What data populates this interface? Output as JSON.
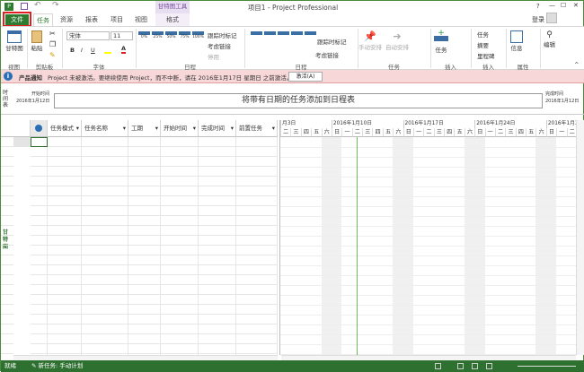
{
  "window": {
    "title": "项目1 - Project Professional",
    "help": "?",
    "minimize": "—",
    "restore": "☐",
    "close": "✕",
    "login": "登录"
  },
  "tabs": {
    "file": "文件",
    "task": "任务",
    "resource": "资源",
    "report": "报表",
    "project": "项目",
    "view": "视图",
    "contextual_group": "甘特图工具",
    "format": "格式"
  },
  "ribbon": {
    "view_group": {
      "label": "视图",
      "gantt": "甘特图"
    },
    "clipboard_group": {
      "label": "剪贴板",
      "paste": "粘贴"
    },
    "font_group": {
      "label": "字体",
      "font_name": "宋体",
      "font_size": "11",
      "bold": "B",
      "italic": "I",
      "underline": "U"
    },
    "schedule_group": {
      "label": "日程",
      "percents": [
        "0%",
        "25%",
        "50%",
        "75%",
        "100%"
      ],
      "mark_on_track": "跟踪时标记",
      "respect_links": "考虑链接",
      "inactivate": "停用"
    },
    "schedule_group2": {
      "label": "日程",
      "mark_on_track": "跟踪时标记",
      "respect_links": "考虑链接"
    },
    "tasks_group": {
      "label": "任务",
      "manual": "手动安排",
      "auto": "自动安排"
    },
    "insert_group": {
      "label": "插入",
      "task": "任务"
    },
    "insert_group2": {
      "label": "插入",
      "task": "任务",
      "summary": "摘要",
      "milestone": "里程碑"
    },
    "properties_group": {
      "label": "属性",
      "info": "信息"
    },
    "editing_group": {
      "label": "编辑"
    }
  },
  "notification": {
    "title": "产品通知",
    "message": "Project 未被激活。要继续使用 Project，而不中断，请在 2016年1月17日 星期日 之前激活。",
    "button": "激活(A)"
  },
  "timeline": {
    "side_label": "时间表",
    "start_label": "开始时间",
    "start_date": "2016年1月12日",
    "placeholder": "将带有日期的任务添加到日程表",
    "finish_label": "完成时间",
    "finish_date": "2016年1月12日"
  },
  "table": {
    "columns": [
      "任务模式",
      "任务名称",
      "工期",
      "开始时间",
      "完成时间",
      "前置任务"
    ]
  },
  "gantt": {
    "side_label": "甘特图",
    "weeks": [
      "月3日",
      "2016年1月10日",
      "2016年1月17日",
      "2016年1月24日",
      "2016年1月31日"
    ],
    "days": [
      "二",
      "三",
      "四",
      "五",
      "六",
      "日",
      "一",
      "二",
      "三",
      "四",
      "五",
      "六",
      "日",
      "一",
      "二",
      "三",
      "四",
      "五",
      "六",
      "日",
      "一",
      "二",
      "三",
      "四",
      "五",
      "六",
      "日",
      "一",
      "二"
    ],
    "today_color": "#6bbf5b"
  },
  "status": {
    "ready": "就绪",
    "new_task": "新任务: 手动计划"
  },
  "colors": {
    "accent": "#2e7030",
    "file_tab": "#2e7b32",
    "notify_bg": "#f7d7d7",
    "highlight_box": "#e02020",
    "contextual": "#7b4fa0"
  }
}
